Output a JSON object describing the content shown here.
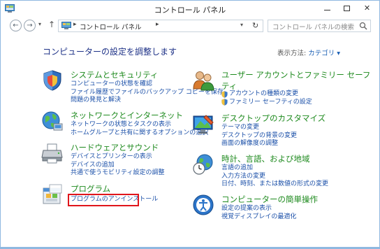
{
  "window": {
    "title": "コントロール パネル",
    "buttons": {
      "minimize": "minimize",
      "maximize": "maximize",
      "close": "✕"
    }
  },
  "nav": {
    "back": "←",
    "forward": "→",
    "up": "↑",
    "address": "コントロール パネル",
    "separator": "▸",
    "dropdown": "▾",
    "refresh": "↻",
    "search_placeholder": "コントロール パネルの検索"
  },
  "main": {
    "heading": "コンピューターの設定を調整します",
    "view_by_label": "表示方法:",
    "view_by_value": "カテゴリ ▾"
  },
  "categories": [
    {
      "title": "システムとセキュリティ",
      "icon": "shield-icon",
      "links": [
        "コンピューターの状態を確認",
        "ファイル履歴でファイルのバックアップ コピーを保存",
        "問題の発見と解決"
      ]
    },
    {
      "title": "ネットワークとインターネット",
      "icon": "network-icon",
      "links": [
        "ネットワークの状態とタスクの表示",
        "ホームグループと共有に関するオプションの選択"
      ]
    },
    {
      "title": "ハードウェアとサウンド",
      "icon": "printer-icon",
      "links": [
        "デバイスとプリンターの表示",
        "デバイスの追加",
        "共通で使うモビリティ設定の調整"
      ]
    },
    {
      "title": "プログラム",
      "icon": "programs-icon",
      "links": [
        "プログラムのアンインストール"
      ]
    },
    {
      "title": "ユーザー アカウントとファミリー セーフティ",
      "title_line1": "ユーザー アカウントとファミリー セーフ",
      "title_line2": "ティ",
      "icon": "users-icon",
      "links": [
        "アカウントの種類の変更",
        "ファミリー セーフティの設定"
      ]
    },
    {
      "title": "デスクトップのカスタマイズ",
      "icon": "desktop-icon",
      "links": [
        "テーマの変更",
        "デスクトップの背景の変更",
        "画面の解像度の調整"
      ]
    },
    {
      "title": "時計、言語、および地域",
      "icon": "clock-globe-icon",
      "links": [
        "言語の追加",
        "入力方法の変更",
        "日付、時刻、または数値の形式の変更"
      ]
    },
    {
      "title": "コンピューターの簡単操作",
      "icon": "ease-of-access-icon",
      "links": [
        "設定の提案の表示",
        "視覚ディスプレイの最適化"
      ]
    }
  ],
  "colors": {
    "category_title": "#1e8a1e",
    "link": "#1a4fa8",
    "heading": "#1e3287",
    "highlight": "#e0151b"
  }
}
